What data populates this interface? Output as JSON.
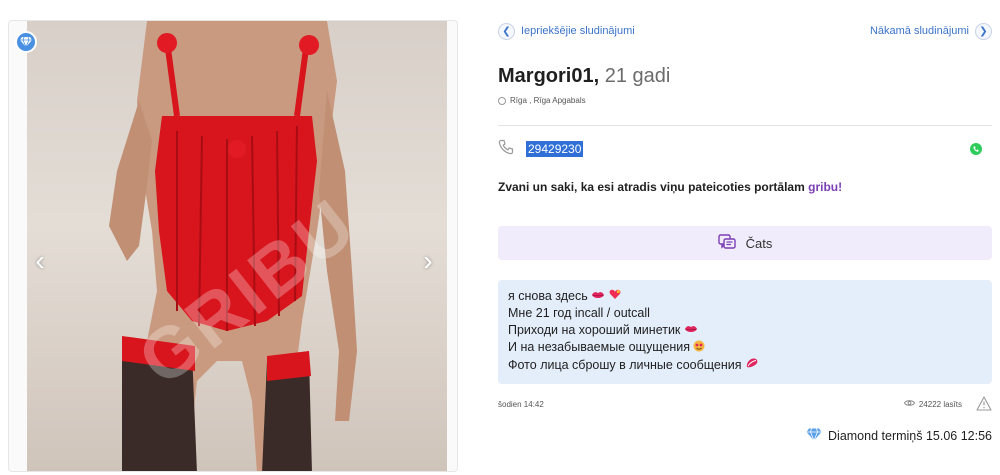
{
  "gallery": {
    "watermark": "GRIBU",
    "prev_arrow": "‹",
    "next_arrow": "›"
  },
  "pager": {
    "prev_label": "Iepriekšējie sludinājumi",
    "next_label": "Nākamā sludinājumi"
  },
  "profile": {
    "name": "Margori01,",
    "age": "21 gadi",
    "location": "Rīga ,  Rīga Apgabals"
  },
  "contact": {
    "phone": "29429230"
  },
  "promo": {
    "text": "Zvani un saki, ka esi atradis viņu pateicoties portālam ",
    "brand": "gribu!"
  },
  "chat": {
    "label": "Čats"
  },
  "description": {
    "lines": [
      "я снова здесь",
      "Мне 21 год incall / outcall",
      "Приходи на хороший минетик",
      "И на незабываемые ощущения",
      "Фото лица сброшу в личные сообщения"
    ]
  },
  "meta": {
    "posted": "šodien 14:42",
    "views": "24222 lasīts"
  },
  "diamond": {
    "label": "Diamond termiņš 15.06 12:56"
  },
  "colors": {
    "accent_blue": "#3b73c9",
    "brand_purple": "#7b3fb5",
    "description_bg": "#e4eefb",
    "chat_bg": "#f1ecfb",
    "whatsapp_green": "#2ecc5b"
  },
  "icons": [
    "diamond-icon",
    "chevron-left-icon",
    "chevron-right-icon",
    "location-icon",
    "phone-icon",
    "whatsapp-icon",
    "chat-icon",
    "eye-icon",
    "warning-icon",
    "lips-emoji",
    "heart-emoji"
  ]
}
